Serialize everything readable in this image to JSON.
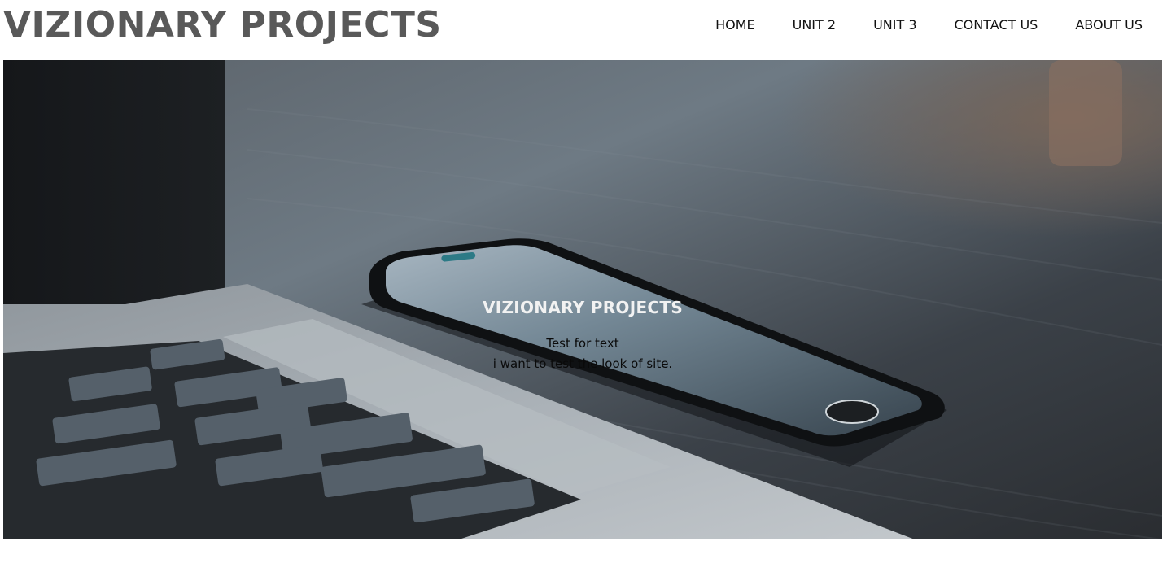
{
  "header": {
    "logo_text": "VIZIONARY PROJECTS",
    "nav": [
      {
        "label": "HOME"
      },
      {
        "label": "UNIT 2"
      },
      {
        "label": "UNIT 3"
      },
      {
        "label": "CONTACT US"
      },
      {
        "label": "ABOUT US"
      }
    ]
  },
  "hero": {
    "image": "laptop-and-smartphone-on-wooden-desk-photo",
    "title": "VIZIONARY PROJECTS",
    "lines": [
      "Test for text",
      "i want to test the look of site."
    ]
  },
  "colors": {
    "logo": "#595959",
    "nav_text": "#111111",
    "hero_title": "#f2f2f2",
    "hero_body": "#0a0a0a"
  }
}
